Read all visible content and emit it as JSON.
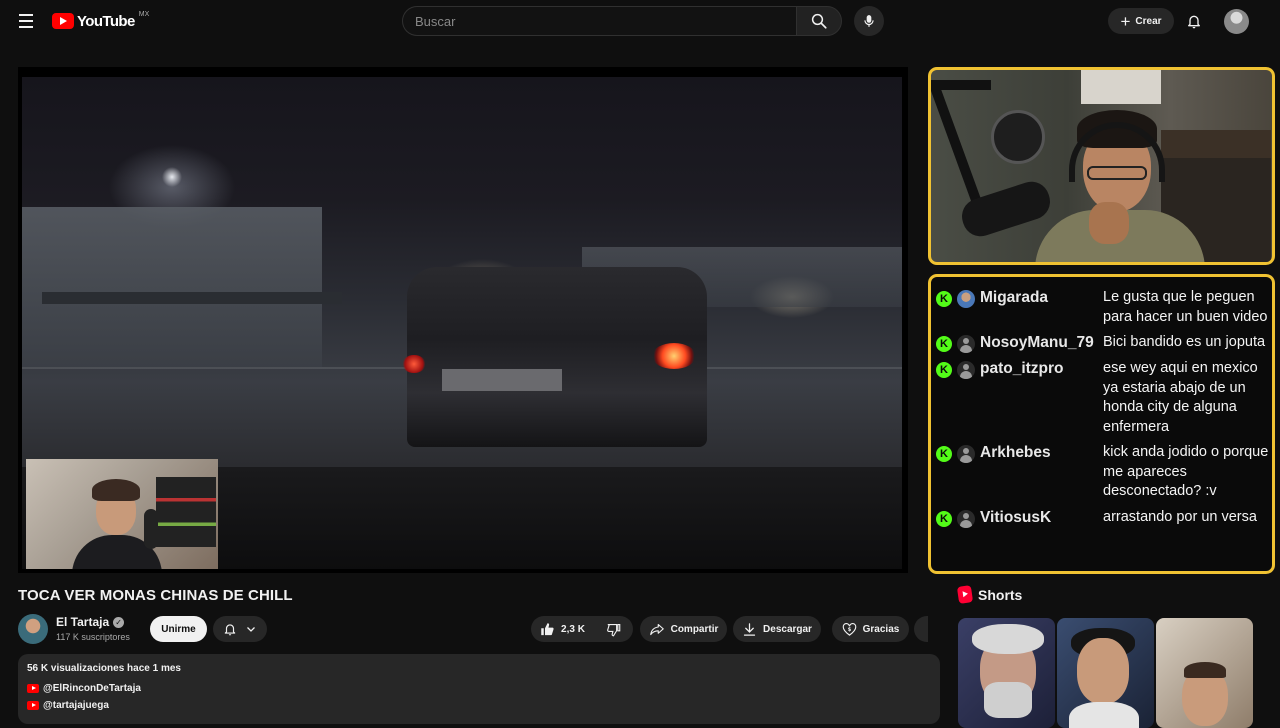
{
  "header": {
    "logo_word": "YouTube",
    "country": "MX",
    "search_placeholder": "Buscar",
    "create_label": "Crear"
  },
  "video": {
    "title": "TOCA VER MONAS CHINAS DE CHILL",
    "channel": {
      "name": "El Tartaja",
      "verified_glyph": "✓",
      "subscribers": "117 K suscriptores",
      "join_label": "Unirme"
    },
    "actions": {
      "likes": "2,3 K",
      "share": "Compartir",
      "download": "Descargar",
      "thanks": "Gracias"
    },
    "description": {
      "meta": "56 K visualizaciones  hace 1 mes",
      "links": [
        "@ElRinconDeTartaja",
        "@tartajajuega"
      ]
    }
  },
  "chat": {
    "badge_letter": "K",
    "messages": [
      {
        "user": "Migarada",
        "avatar": "photo",
        "text": "Le gusta que le peguen para hacer un buen video"
      },
      {
        "user": "NosoyManu_79",
        "avatar": "default",
        "text": "Bici bandido es un joputa"
      },
      {
        "user": "pato_itzpro",
        "avatar": "default",
        "text": "ese wey aqui en mexico ya estaria abajo de un honda city de alguna enfermera"
      },
      {
        "user": "Arkhebes",
        "avatar": "default",
        "text": "kick anda jodido o porque me apareces desconectado? :v"
      },
      {
        "user": "VitiosusK",
        "avatar": "default",
        "text": "arrastando por un versa"
      }
    ]
  },
  "shorts": {
    "title": "Shorts"
  },
  "colors": {
    "background": "#0f0f0f",
    "brand_red": "#ff0000",
    "overlay_border": "#f0c232",
    "kick_green": "#53fc18",
    "pill_bg": "#272727"
  },
  "icons": [
    "menu-icon",
    "search-icon",
    "mic-icon",
    "plus-icon",
    "bell-icon",
    "verified-icon",
    "chevron-down-icon",
    "thumbs-up-icon",
    "thumbs-down-icon",
    "share-icon",
    "download-icon",
    "thanks-icon",
    "shorts-icon"
  ]
}
